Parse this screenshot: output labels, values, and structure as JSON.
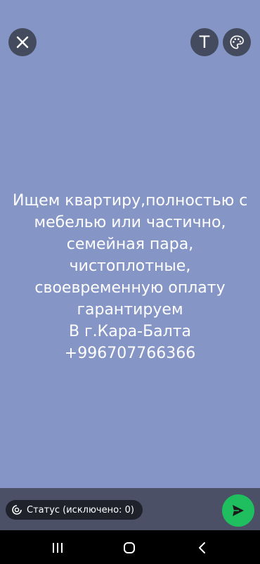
{
  "toolbar": {
    "close_icon": "close-icon",
    "text_tool_label": "T",
    "palette_icon": "palette-icon"
  },
  "status": {
    "lines": [
      "Ищем квартиру,полностью с",
      "мебелью или частично,",
      "семейная пара,",
      "чистоплотные,",
      "своевременную оплату",
      "гарантируем",
      "В г.Кара-Балта",
      "+996707766366"
    ],
    "background_color": "#8595c6",
    "text_color": "#ffffff"
  },
  "bottom": {
    "privacy_label": "Статус (исключено: 0)",
    "send_icon": "send-icon",
    "send_color": "#1fbf5f"
  },
  "navigation": {
    "recents_icon": "recents-icon",
    "home_icon": "home-icon",
    "back_icon": "back-icon"
  }
}
